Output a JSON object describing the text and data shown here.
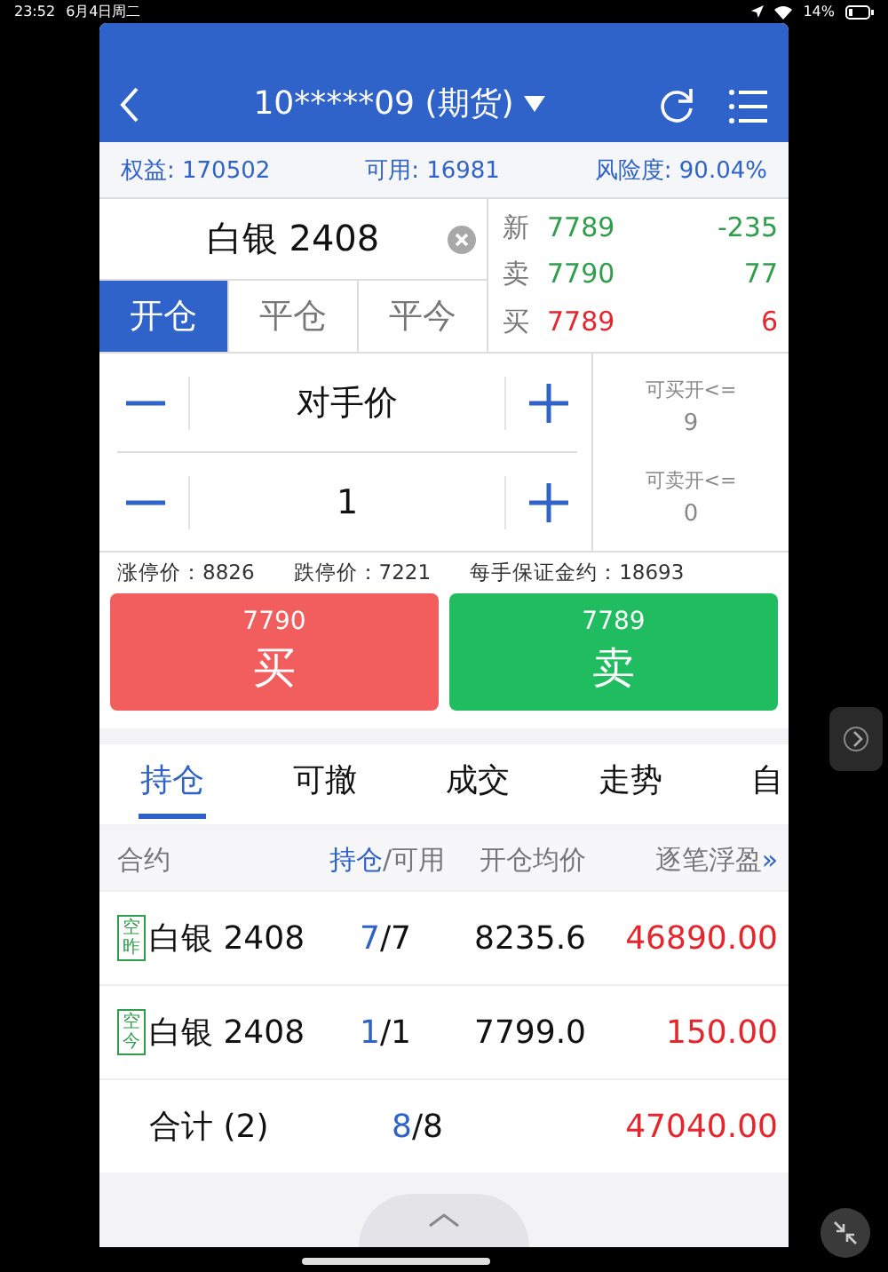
{
  "status_bar": {
    "time": "23:52",
    "date": "6月4日周二",
    "battery": "14%"
  },
  "header": {
    "title": "10*****09 (期货)"
  },
  "account": [
    "权益: 170502",
    "可用: 16981",
    "风险度: 90.04%"
  ],
  "contract": {
    "name": "白银 2408"
  },
  "open_close_tabs": [
    {
      "label": "开仓",
      "selected": true
    },
    {
      "label": "平仓",
      "selected": false
    },
    {
      "label": "平今",
      "selected": false
    }
  ],
  "quotes": [
    {
      "label": "新",
      "price": "7789",
      "change": "-235",
      "color": "#2f9e4a"
    },
    {
      "label": "卖",
      "price": "7790",
      "change": "77",
      "color": "#2f9e4a"
    },
    {
      "label": "买",
      "price": "7789",
      "change": "6",
      "color": "#e5262d"
    }
  ],
  "steppers": [
    {
      "value": "对手价"
    },
    {
      "value": "1"
    }
  ],
  "limits": [
    {
      "label": "可买开<=",
      "value": "9"
    },
    {
      "label": "可卖开<=",
      "value": "0"
    }
  ],
  "price_limits": [
    "涨停价：8826",
    "跌停价：7221",
    "每手保证金约：18693"
  ],
  "actions": [
    {
      "kind": "buy",
      "price": "7790",
      "label": "买"
    },
    {
      "kind": "sell",
      "price": "7789",
      "label": "卖"
    }
  ],
  "tabs": [
    {
      "label": "持仓",
      "selected": true
    },
    {
      "label": "可撤",
      "selected": false
    },
    {
      "label": "成交",
      "selected": false
    },
    {
      "label": "走势",
      "selected": false
    },
    {
      "label": "自",
      "selected": false
    }
  ],
  "positions": {
    "columns": {
      "contract": "合约",
      "held": "持仓",
      "available": "/可用",
      "avg_price": "开仓均价",
      "pnl": "逐笔浮盈",
      "more": "»"
    },
    "rows": [
      {
        "tag": "空昨",
        "contract": "白银 2408",
        "held": "7",
        "available": "/7",
        "avg_price": "8235.6",
        "pnl": "46890.00"
      },
      {
        "tag": "空今",
        "contract": "白银 2408",
        "held": "1",
        "available": "/1",
        "avg_price": "7799.0",
        "pnl": "150.00"
      }
    ],
    "total": {
      "label": "合计 (2)",
      "held": "8",
      "available": "/8",
      "pnl": "47040.00"
    }
  }
}
